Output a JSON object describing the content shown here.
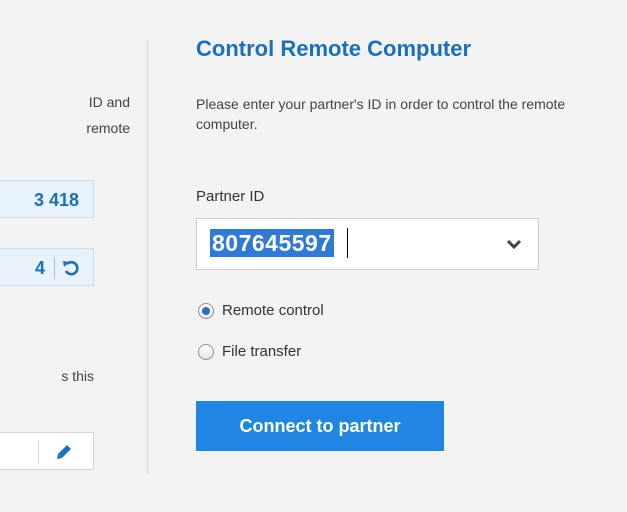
{
  "left_panel": {
    "text_line_1": "ID and",
    "text_line_2": "remote",
    "your_id": "3 418",
    "password": "4",
    "text_line_3": "s this",
    "password_field_value": ""
  },
  "control_remote": {
    "title": "Control Remote Computer",
    "description": "Please enter your partner's ID in order to control the remote computer.",
    "partner_id_label": "Partner ID",
    "partner_id_value": "807645597",
    "options": [
      {
        "label": "Remote control",
        "selected": true
      },
      {
        "label": "File transfer",
        "selected": false
      }
    ],
    "connect_label": "Connect to partner"
  },
  "colors": {
    "accent": "#1b6fbf",
    "button": "#1f87e3",
    "selection": "#2e7ad6",
    "background": "#f3f3f3"
  },
  "icons": [
    "refresh-icon",
    "pencil-icon",
    "chevron-down-icon"
  ]
}
